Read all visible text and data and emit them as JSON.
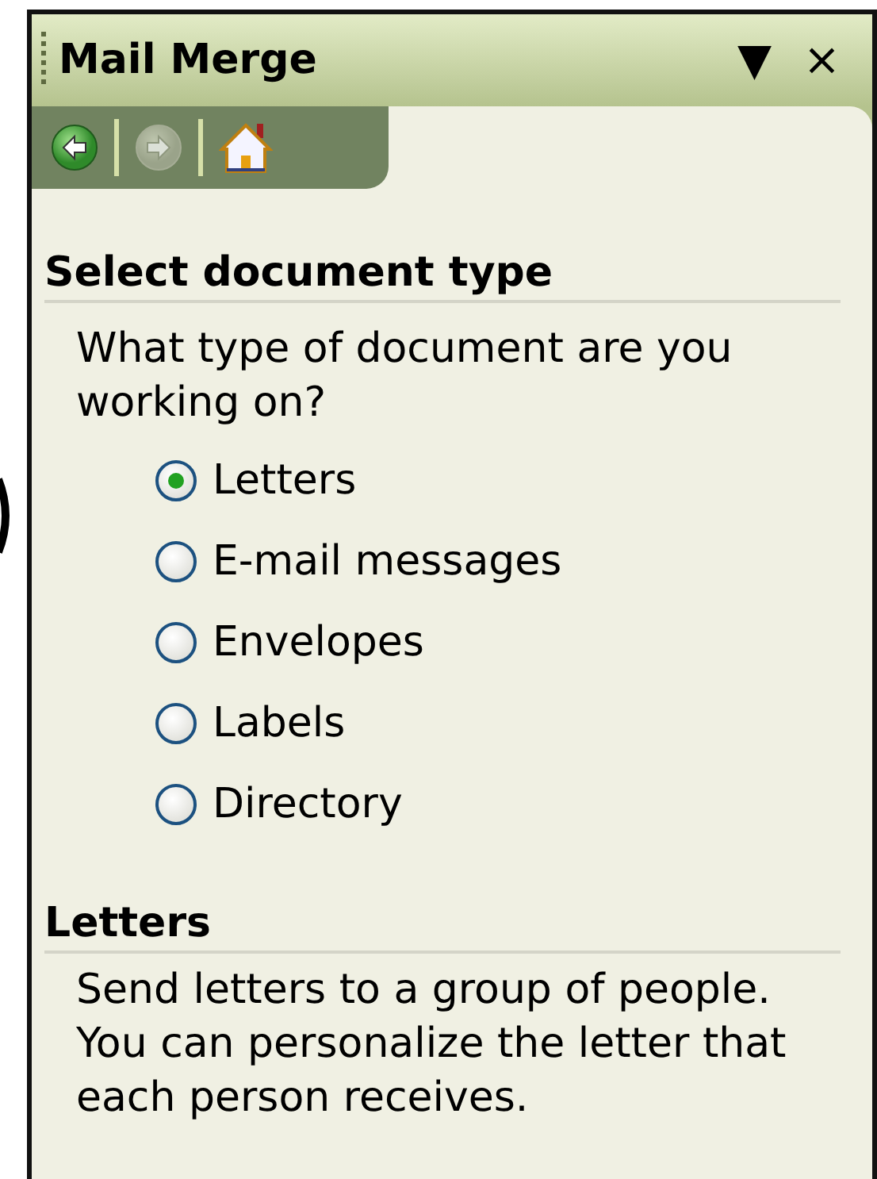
{
  "pane": {
    "title": "Mail Merge",
    "menu_button": "▼",
    "close_button": "×"
  },
  "nav": [
    {
      "kind": "back",
      "disabled": false
    },
    {
      "kind": "forward",
      "disabled": true
    },
    {
      "kind": "home",
      "disabled": false
    }
  ],
  "sections": [
    {
      "heading": "Select document type",
      "text": "What type of document are you working on?",
      "options": [
        {
          "label": "Letters",
          "selected": true
        },
        {
          "label": "E-mail messages",
          "selected": false
        },
        {
          "label": "Envelopes",
          "selected": false
        },
        {
          "label": "Labels",
          "selected": false
        },
        {
          "label": "Directory",
          "selected": false
        }
      ]
    },
    {
      "heading": "Letters",
      "text": "Send letters to a group of people. You can personalize the letter that each person receives."
    }
  ]
}
